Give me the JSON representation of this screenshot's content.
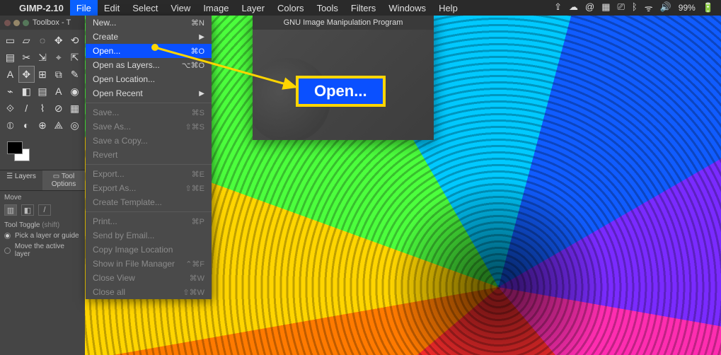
{
  "menubar": {
    "apple": "",
    "app_name": "GIMP-2.10",
    "items": [
      "File",
      "Edit",
      "Select",
      "View",
      "Image",
      "Layer",
      "Colors",
      "Tools",
      "Filters",
      "Windows",
      "Help"
    ],
    "active_index": 0,
    "right": {
      "icons": [
        "dropbox-icon",
        "cloud-icon",
        "at-icon",
        "grid-icon",
        "screen-icon",
        "bluetooth-icon",
        "wifi-icon",
        "volume-icon"
      ],
      "icon_glyphs": [
        "⇪",
        "☁",
        "@",
        "▦",
        "⎚",
        "ᛒ",
        "ᯤ",
        "🔊"
      ],
      "battery_pct": "99%",
      "battery_glyph": "🔋"
    }
  },
  "toolbox": {
    "title": "Toolbox - T",
    "tools": [
      "▭",
      "▱",
      "◌",
      "✥",
      "⟲",
      "▤",
      "✂",
      "⇲",
      "⌖",
      "⇱",
      "A",
      "✥",
      "⊞",
      "⧉",
      "✎",
      "⌁",
      "◧",
      "▤",
      "A",
      "◉",
      "⟐",
      "/",
      "⌇",
      "⊘",
      "▦",
      "⦶",
      "◐",
      "⊕",
      "⟁",
      "◎"
    ],
    "selected_tool_index": 11,
    "swatch_fg": "#000000",
    "swatch_bg": "#ffffff",
    "tabs": [
      "Layers",
      "Tool Options"
    ],
    "active_tab": 1,
    "move_label": "Move",
    "move_icon_row": [
      "▥",
      "◧",
      "/"
    ],
    "toggle_label": "Tool Toggle",
    "toggle_hint": "(shift)",
    "opt1": "Pick a layer or guide",
    "opt2": "Move the active layer"
  },
  "file_menu": {
    "groups": [
      [
        {
          "label": "New...",
          "kbd": "⌘N",
          "disabled": false,
          "sub": false
        },
        {
          "label": "Create",
          "kbd": "",
          "disabled": false,
          "sub": true
        },
        {
          "label": "Open...",
          "kbd": "⌘O",
          "disabled": false,
          "sub": false,
          "hi": true
        },
        {
          "label": "Open as Layers...",
          "kbd": "⌥⌘O",
          "disabled": false,
          "sub": false
        },
        {
          "label": "Open Location...",
          "kbd": "",
          "disabled": false,
          "sub": false
        },
        {
          "label": "Open Recent",
          "kbd": "",
          "disabled": false,
          "sub": true
        }
      ],
      [
        {
          "label": "Save...",
          "kbd": "⌘S",
          "disabled": true,
          "sub": false
        },
        {
          "label": "Save As...",
          "kbd": "⇧⌘S",
          "disabled": true,
          "sub": false
        },
        {
          "label": "Save a Copy...",
          "kbd": "",
          "disabled": true,
          "sub": false
        },
        {
          "label": "Revert",
          "kbd": "",
          "disabled": true,
          "sub": false
        }
      ],
      [
        {
          "label": "Export...",
          "kbd": "⌘E",
          "disabled": true,
          "sub": false
        },
        {
          "label": "Export As...",
          "kbd": "⇧⌘E",
          "disabled": true,
          "sub": false
        },
        {
          "label": "Create Template...",
          "kbd": "",
          "disabled": true,
          "sub": false
        }
      ],
      [
        {
          "label": "Print...",
          "kbd": "⌘P",
          "disabled": true,
          "sub": false
        },
        {
          "label": "Send by Email...",
          "kbd": "",
          "disabled": true,
          "sub": false
        },
        {
          "label": "Copy Image Location",
          "kbd": "",
          "disabled": true,
          "sub": false
        },
        {
          "label": "Show in File Manager",
          "kbd": "⌃⌘F",
          "disabled": true,
          "sub": false
        },
        {
          "label": "Close View",
          "kbd": "⌘W",
          "disabled": true,
          "sub": false
        },
        {
          "label": "Close all",
          "kbd": "⇧⌘W",
          "disabled": true,
          "sub": false
        }
      ]
    ]
  },
  "splash": {
    "title": "GNU Image Manipulation Program"
  },
  "callout": {
    "label": "Open..."
  }
}
